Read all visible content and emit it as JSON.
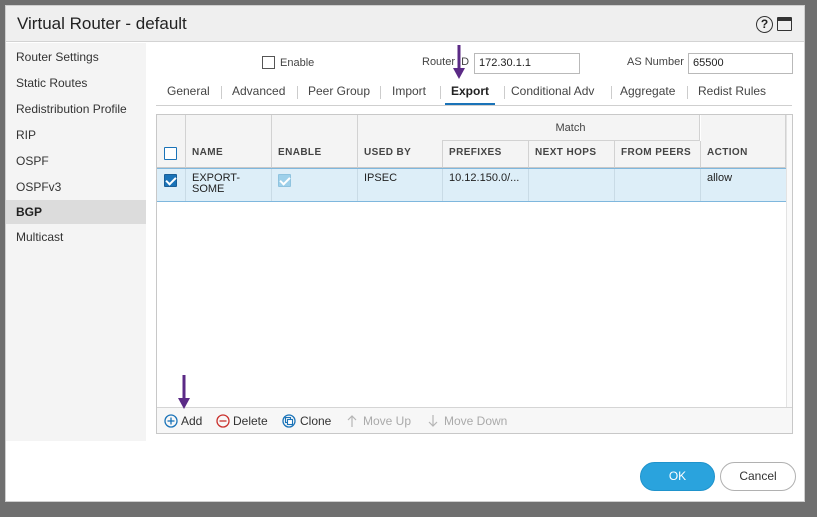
{
  "dialog": {
    "title": "Virtual Router - default",
    "help_icon": "?",
    "maximize_icon": "maximize-icon"
  },
  "sidebar": {
    "items": [
      {
        "label": "Router Settings"
      },
      {
        "label": "Static Routes"
      },
      {
        "label": "Redistribution Profile"
      },
      {
        "label": "RIP"
      },
      {
        "label": "OSPF"
      },
      {
        "label": "OSPFv3"
      },
      {
        "label": "BGP"
      },
      {
        "label": "Multicast"
      }
    ],
    "active_item": "BGP"
  },
  "form": {
    "enable_label": "Enable",
    "router_id_label": "Router ID",
    "router_id_value": "172.30.1.1",
    "as_number_label": "AS Number",
    "as_number_value": "65500"
  },
  "tabs": [
    {
      "label": "General"
    },
    {
      "label": "Advanced"
    },
    {
      "label": "Peer Group"
    },
    {
      "label": "Import"
    },
    {
      "label": "Export"
    },
    {
      "label": "Conditional Adv"
    },
    {
      "label": "Aggregate"
    },
    {
      "label": "Redist Rules"
    }
  ],
  "active_tab": "Export",
  "grid": {
    "group_header": "Match",
    "columns": [
      "NAME",
      "ENABLE",
      "USED BY",
      "PREFIXES",
      "NEXT HOPS",
      "FROM PEERS",
      "ACTION"
    ],
    "rows": [
      {
        "selected": true,
        "name_line1": "EXPORT-",
        "name_line2": "SOME",
        "enable": true,
        "used_by": "IPSEC",
        "prefixes": "10.12.150.0/...",
        "next_hops": "",
        "from_peers": "",
        "action": "allow"
      }
    ]
  },
  "toolbar": {
    "add": "Add",
    "delete": "Delete",
    "clone": "Clone",
    "move_up": "Move Up",
    "move_down": "Move Down"
  },
  "buttons": {
    "ok": "OK",
    "cancel": "Cancel"
  },
  "colors": {
    "accent": "#1a73b8",
    "ok_button": "#2aa3dd",
    "annotation_arrow": "#5b2a86",
    "selected_row": "#ddeef8"
  }
}
